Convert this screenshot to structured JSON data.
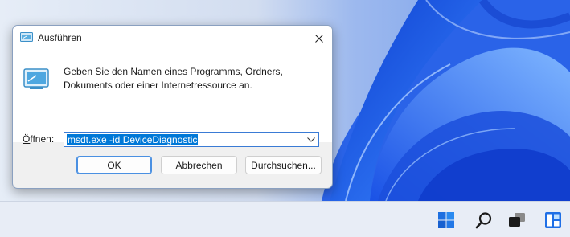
{
  "dialog": {
    "title": "Ausführen",
    "description": "Geben Sie den Namen eines Programms, Ordners, Dokuments oder einer Internetressource an.",
    "open_label_prefix": "Ö",
    "open_label_rest": "ffnen:",
    "open_value": "msdt.exe -id DeviceDiagnostic",
    "ok_label": "OK",
    "cancel_label": "Abbrechen",
    "browse_label_prefix": "D",
    "browse_label_rest": "urchsuchen..."
  },
  "taskbar": {
    "icons": [
      "start-icon",
      "search-icon",
      "task-view-icon",
      "widgets-icon"
    ]
  },
  "colors": {
    "accent": "#0078d7",
    "wallpaper_blue": "#1f5fe0",
    "taskbar": "#e8edf6"
  }
}
